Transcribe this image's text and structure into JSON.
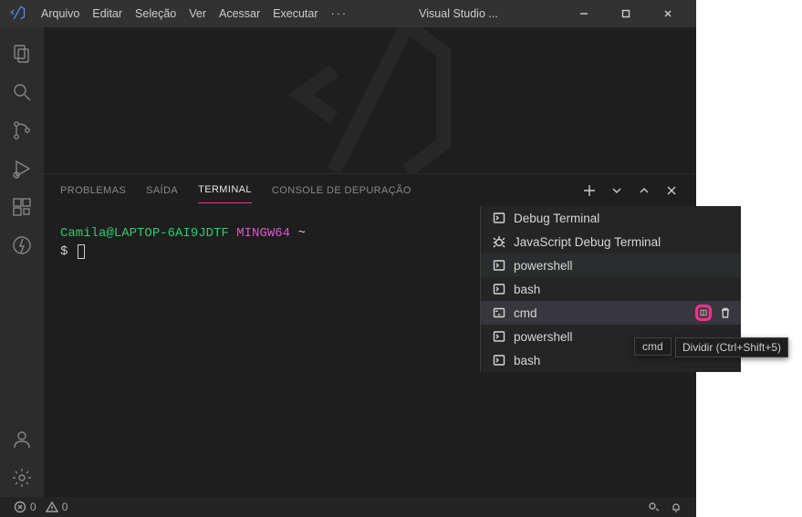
{
  "titlebar": {
    "menus": [
      "Arquivo",
      "Editar",
      "Seleção",
      "Ver",
      "Acessar",
      "Executar"
    ],
    "title": "Visual Studio ..."
  },
  "panel": {
    "tabs": {
      "problems": "PROBLEMAS",
      "output": "SAÍDA",
      "terminal": "TERMINAL",
      "debug_console": "CONSOLE DE DEPURAÇÃO"
    }
  },
  "terminal": {
    "user": "Camila@LAPTOP-6AI9JDTF",
    "system": "MINGW64",
    "tilde": "~",
    "dollar": "$"
  },
  "dropdown": {
    "items": [
      {
        "label": "Debug Terminal",
        "icon": "terminal"
      },
      {
        "label": "JavaScript Debug Terminal",
        "icon": "bug"
      },
      {
        "label": "powershell",
        "icon": "terminal",
        "hover": true
      },
      {
        "label": "bash",
        "icon": "terminal"
      },
      {
        "label": "cmd",
        "icon": "cmd",
        "selected": true,
        "actions": true
      },
      {
        "label": "powershell",
        "icon": "terminal"
      },
      {
        "label": "bash",
        "icon": "terminal"
      }
    ]
  },
  "float": {
    "term_badge": "cmd",
    "tooltip": "Dividir (Ctrl+Shift+5)"
  },
  "statusbar": {
    "errors": "0",
    "warnings": "0"
  }
}
